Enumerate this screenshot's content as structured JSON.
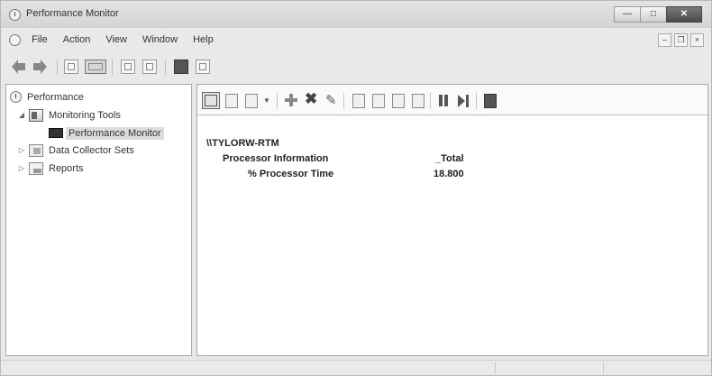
{
  "window": {
    "title": "Performance Monitor"
  },
  "caption_buttons": {
    "minimize": "—",
    "maximize": "□",
    "close": "✕"
  },
  "menubar": {
    "items": [
      "File",
      "Action",
      "View",
      "Window",
      "Help"
    ],
    "mdi": {
      "minimize": "–",
      "restore": "❐",
      "close": "×"
    }
  },
  "toolbar": {
    "icons": [
      "back-icon",
      "forward-icon",
      "up-icon",
      "show-hide-console-tree-icon",
      "properties-icon",
      "export-icon",
      "help-icon",
      "action-pane-icon"
    ]
  },
  "tree": {
    "root": "Performance",
    "monitoring_tools": "Monitoring Tools",
    "performance_monitor": "Performance Monitor",
    "data_collector_sets": "Data Collector Sets",
    "reports": "Reports"
  },
  "report": {
    "machine": "\\\\TYLORW-RTM",
    "object": "Processor Information",
    "instance": "_Total",
    "counter": "% Processor Time",
    "value": "18.800"
  },
  "colors": {
    "selected_background": "#dcdcdc",
    "pane_border": "#a8a8a8",
    "window_background": "#e9e9e9"
  }
}
